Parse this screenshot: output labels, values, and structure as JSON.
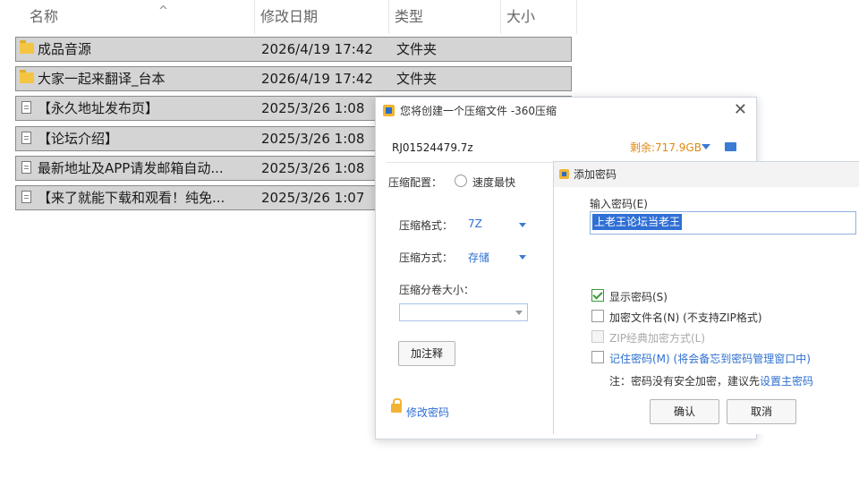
{
  "explorer": {
    "headers": {
      "name": "名称",
      "modified": "修改日期",
      "type": "类型",
      "size": "大小"
    },
    "sort_indicator": "^",
    "rows": [
      {
        "name": "成品音源",
        "date": "2026/4/19 17:42",
        "type": "文件夹",
        "icon": "folder-icon"
      },
      {
        "name": "大家一起来翻译_台本",
        "date": "2026/4/19 17:42",
        "type": "文件夹",
        "icon": "folder-icon"
      },
      {
        "name": "【永久地址发布页】",
        "date": "2025/3/26 1:08",
        "type": "",
        "icon": "file-icon"
      },
      {
        "name": "【论坛介绍】",
        "date": "2025/3/26 1:08",
        "type": "",
        "icon": "file-icon"
      },
      {
        "name": "最新地址及APP请发邮箱自动...",
        "date": "2025/3/26 1:08",
        "type": "",
        "icon": "file-icon"
      },
      {
        "name": "【来了就能下载和观看！纯免...",
        "date": "2025/3/26 1:07",
        "type": "",
        "icon": "file-icon"
      }
    ]
  },
  "compress_dialog": {
    "title": "您将创建一个压缩文件 -360压缩",
    "close": "✕",
    "filename": "RJ01524479.7z",
    "free_space": "剩余:717.9GB",
    "config_label": "压缩配置：",
    "config_option": "速度最快",
    "format_label": "压缩格式：",
    "format_value": "7Z",
    "method_label": "压缩方式：",
    "method_value": "存储",
    "split_label": "压缩分卷大小：",
    "split_value": "",
    "comment_button": "加注释",
    "change_password_link": "修改密码"
  },
  "password_dialog": {
    "title": "添加密码",
    "input_label": "输入密码(E)",
    "password_value": "上老王论坛当老王",
    "show_password": {
      "label": "显示密码(S)",
      "checked": true
    },
    "encrypt_filenames": {
      "label": "加密文件名(N) (不支持ZIP格式)",
      "checked": false
    },
    "zip_classic": {
      "label": "ZIP经典加密方式(L)",
      "checked": false,
      "disabled": true
    },
    "remember": {
      "label": "记住密码(M) (将会备忘到密码管理窗口中)",
      "checked": false
    },
    "note_prefix": "注：密码没有安全加密，建议先",
    "note_link": "设置主密码",
    "ok": "确认",
    "cancel": "取消"
  },
  "colors": {
    "selection": "#d4d4d4",
    "accent": "#2e6fd0",
    "free_space": "#e08a12",
    "checkbox_on": "#3a9a3a"
  }
}
